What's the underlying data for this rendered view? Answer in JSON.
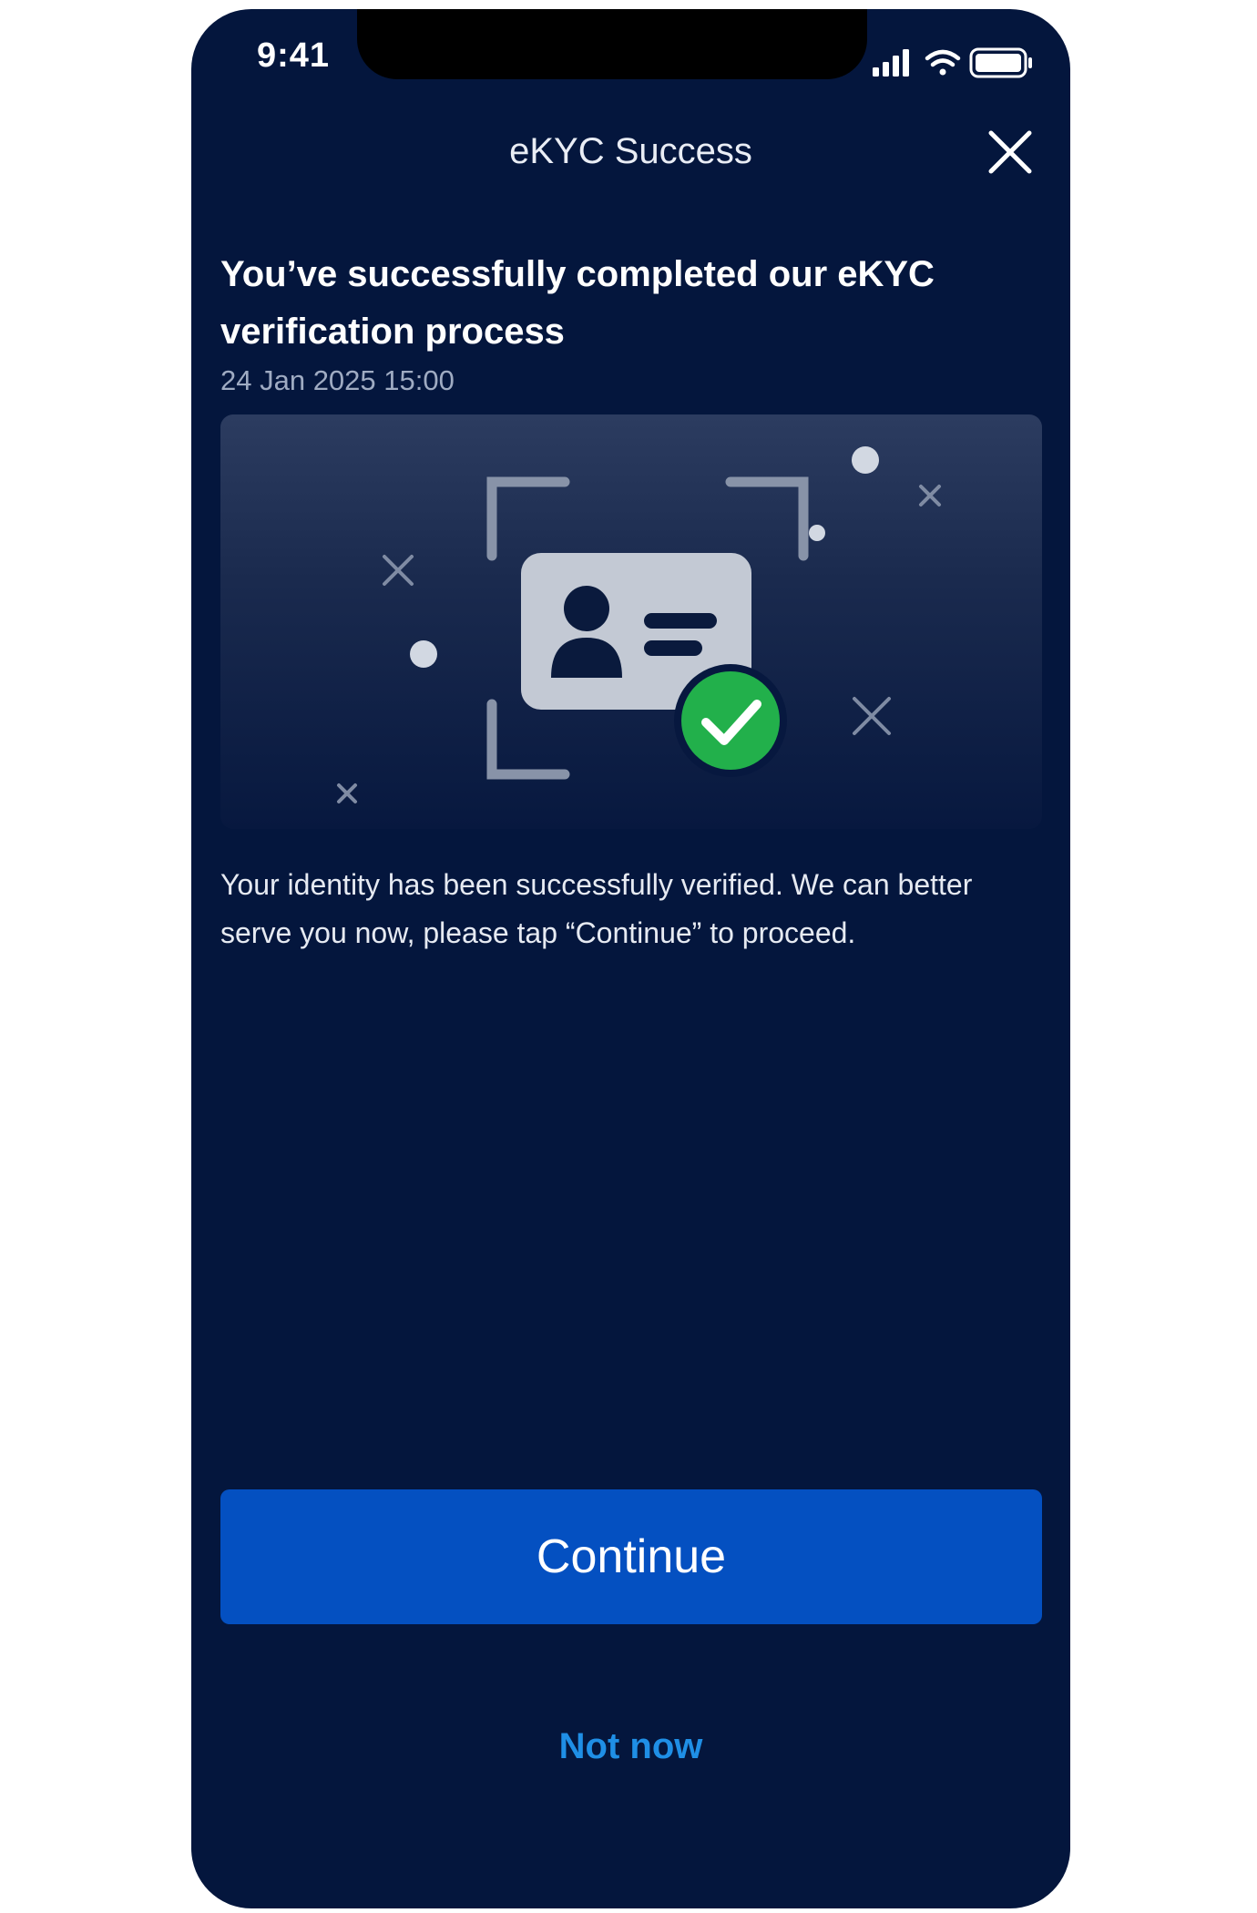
{
  "status_bar": {
    "time": "9:41",
    "icons": [
      "signal-icon",
      "wifi-icon",
      "battery-icon"
    ]
  },
  "header": {
    "title": "eKYC Success",
    "close_icon": "close-icon"
  },
  "content": {
    "headline": "You’ve successfully completed our eKYC verification process",
    "timestamp": "24 Jan 2025 15:00",
    "illustration": "id-card-verified-illustration",
    "message": "Your identity has been successfully verified. We can better serve you now, please tap “Continue” to proceed."
  },
  "actions": {
    "continue_label": "Continue",
    "not_now_label": "Not now"
  },
  "colors": {
    "background": "#04163d",
    "primary_button": "#0450c1",
    "link": "#1f8fe6",
    "success": "#22b04b"
  }
}
